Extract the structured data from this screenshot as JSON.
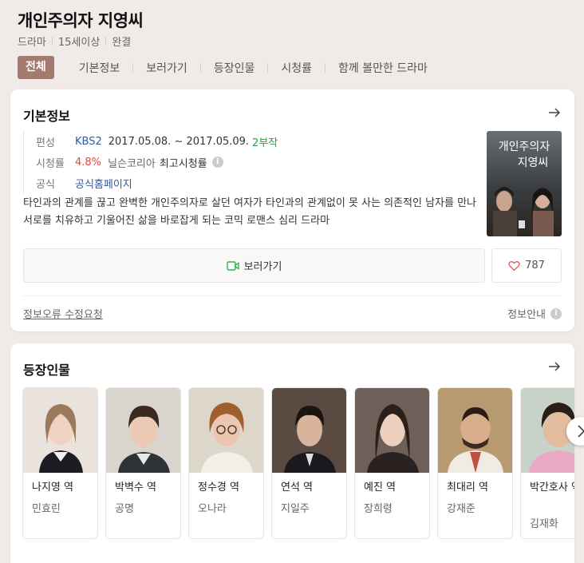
{
  "header": {
    "title": "개인주의자 지영씨",
    "meta": [
      "드라마",
      "15세이상",
      "완결"
    ]
  },
  "tabs": [
    "전체",
    "기본정보",
    "보러가기",
    "등장인물",
    "시청률",
    "함께 볼만한 드라마"
  ],
  "basic_info": {
    "title": "기본정보",
    "broadcast_label": "편성",
    "channel": "KBS2",
    "dates": "2017.05.08. ~ 2017.05.09.",
    "episodes": "2부작",
    "rating_label": "시청률",
    "rating_value": "4.8%",
    "rating_source": "닐슨코리아",
    "rating_note": "최고시청률",
    "official_label": "공식",
    "official_link": "공식홈페이지",
    "description": "타인과의 관계를 끊고 완벽한 개인주의자로 살던 여자가 타인과의 관계없이 못 사는 의존적인 남자를 만나 서로를 치유하고 기울어진 삶을 바로잡게 되는 코믹 로맨스 심리 드라마",
    "poster_text_line1": "개인주의자",
    "poster_text_line2": "지영씨",
    "watch_label": "보러가기",
    "like_count": "787",
    "report_label": "정보오류 수정요청",
    "guide_label": "정보안내"
  },
  "cast": {
    "title": "등장인물",
    "members": [
      {
        "role": "나지영 역",
        "actor": "민효린"
      },
      {
        "role": "박벽수 역",
        "actor": "공명"
      },
      {
        "role": "정수경 역",
        "actor": "오나라"
      },
      {
        "role": "연석 역",
        "actor": "지일주"
      },
      {
        "role": "예진 역",
        "actor": "장희령"
      },
      {
        "role": "최대리 역",
        "actor": "강재준"
      },
      {
        "role": "박간호사 역",
        "actor": "김재화"
      }
    ]
  },
  "colors": {
    "active_tab": "#a27a6e",
    "link": "#2f5aa6",
    "rating": "#e04a3b",
    "episodes": "#29a04b"
  }
}
